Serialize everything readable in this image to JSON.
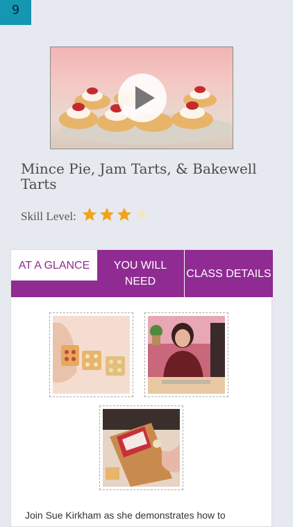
{
  "status": {
    "badge": "9"
  },
  "video": {
    "play_icon": "play-icon"
  },
  "class_info": {
    "title": "Mince Pie, Jam Tarts, & Bakewell Tarts",
    "skill_label": "Skill Level:",
    "skill_rating": 3,
    "skill_max": 5
  },
  "tabs": [
    {
      "label": "AT A GLANCE"
    },
    {
      "label": "YOU WILL NEED"
    },
    {
      "label": "CLASS DETAILS"
    }
  ],
  "content": {
    "description": "Join Sue Kirkham as she demonstrates how to"
  },
  "colors": {
    "accent": "#8f2b92",
    "star_on": "#f3a317",
    "star_off": "#f1e7c8"
  }
}
